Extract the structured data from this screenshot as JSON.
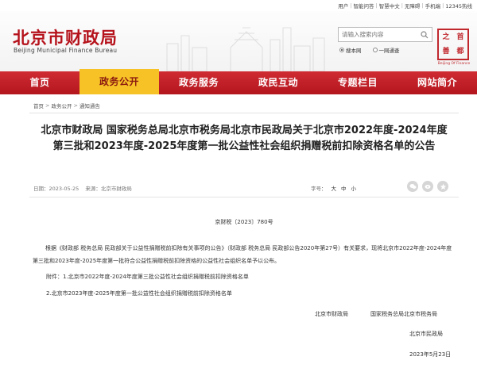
{
  "topbar": {
    "links": [
      "用户",
      "智能问答",
      "智慧中文",
      "无障碍",
      "手机端",
      "12345热线"
    ]
  },
  "header": {
    "title": "北京市财政局",
    "subtitle": "Beijing Municipal Finance Bureau"
  },
  "search": {
    "placeholder": "请输入搜索内容",
    "options": [
      "搜本网",
      "一网通查"
    ],
    "selected": "搜本网"
  },
  "seal": {
    "chars": [
      "之",
      "首",
      "都",
      "善"
    ],
    "caption": "Beijing Of Finance"
  },
  "nav": {
    "items": [
      "首页",
      "政务公开",
      "政务服务",
      "政民互动",
      "专题栏目",
      "网站简介"
    ],
    "active": "政务公开"
  },
  "breadcrumb": [
    "首页",
    "政务公开",
    "通知通告"
  ],
  "article": {
    "title": "北京市财政局 国家税务总局北京市税务局北京市民政局关于北京市2022年度-2024年度第三批和2023年度-2025年度第一批公益性社会组织捐赠税前扣除资格名单的公告",
    "date": "日期：2023-05-25",
    "source": "来源：北京市财政局",
    "fontsize_label": "字号：",
    "fontsizes": [
      "大",
      "中",
      "小"
    ],
    "doc_number": "京财税〔2023〕780号",
    "body": "根据《财政部 税务总局 民政部关于公益性捐赠税前扣除有关事项的公告》（财政部 税务总局 民政部公告2020年第27号）有关要求，现将北京市2022年度-2024年度第三批和2023年度-2025年度第一批符合公益性捐赠税前扣除资格的公益性社会组织名单予以公布。",
    "attachment_1": "附件：1.北京市2022年度-2024年度第三批公益性社会组织捐赠税前扣除资格名单",
    "attachment_2": "2.北京市2023年度-2025年度第一批公益性社会组织捐赠税前扣除资格名单",
    "signatures": [
      "北京市财政局",
      "国家税务总局北京市税务局",
      "北京市民政局"
    ],
    "sign_date": "2023年5月23日"
  },
  "icons": {
    "search": "search-icon",
    "share": [
      "wechat-icon",
      "weibo-icon",
      "qzone-icon"
    ]
  },
  "colors": {
    "brand_red": "#b5121b",
    "nav_active": "#f7c226"
  }
}
